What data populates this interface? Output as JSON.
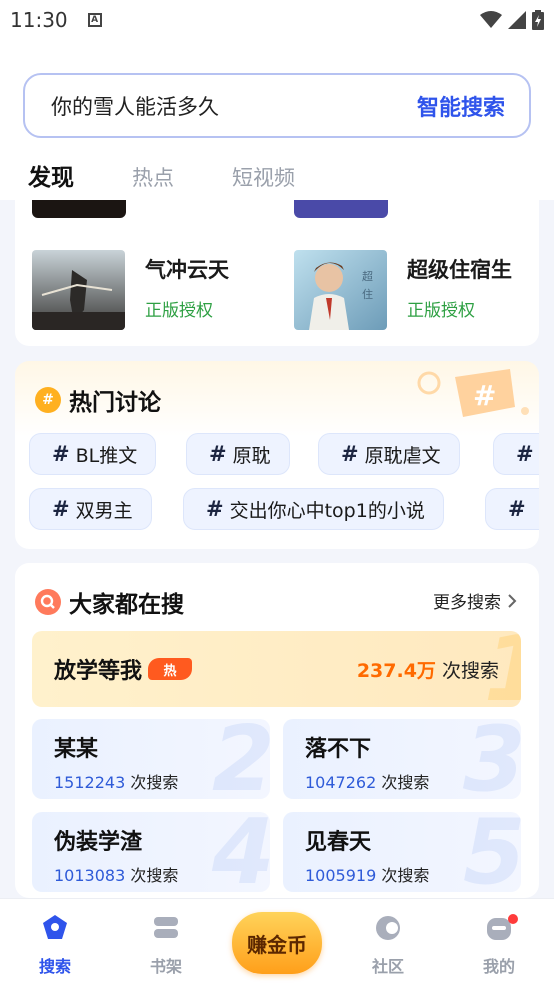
{
  "status_bar": {
    "time": "11:30"
  },
  "search": {
    "placeholder": "你的雪人能活多久",
    "button": "智能搜索"
  },
  "tabs": [
    {
      "label": "发现",
      "active": true
    },
    {
      "label": "热点",
      "active": false
    },
    {
      "label": "短视频",
      "active": false
    }
  ],
  "books": [
    {
      "title": "气冲云天",
      "tag": "正版授权"
    },
    {
      "title": "超级住宿生",
      "tag": "正版授权"
    }
  ],
  "hot_topics": {
    "title": "热门讨论",
    "row1": [
      "BL推文",
      "原耽",
      "原耽虐文"
    ],
    "row2": [
      "双男主",
      "交出你心中top1的小说"
    ]
  },
  "trending": {
    "title": "大家都在搜",
    "more": "更多搜索",
    "hot_badge": "热",
    "count_suffix": "次搜索",
    "top": {
      "rank": "1",
      "name": "放学等我",
      "count": "237.4万"
    },
    "items": [
      {
        "rank": "2",
        "name": "某某",
        "count": "1512243"
      },
      {
        "rank": "3",
        "name": "落不下",
        "count": "1047262"
      },
      {
        "rank": "4",
        "name": "伪装学渣",
        "count": "1013083"
      },
      {
        "rank": "5",
        "name": "见春天",
        "count": "1005919"
      }
    ]
  },
  "bottom_nav": {
    "search": "搜索",
    "shelf": "书架",
    "earn": "赚金币",
    "community": "社区",
    "mine": "我的"
  },
  "colors": {
    "accent": "#2f54eb",
    "green": "#2ea043",
    "orange": "#ff6a00"
  }
}
